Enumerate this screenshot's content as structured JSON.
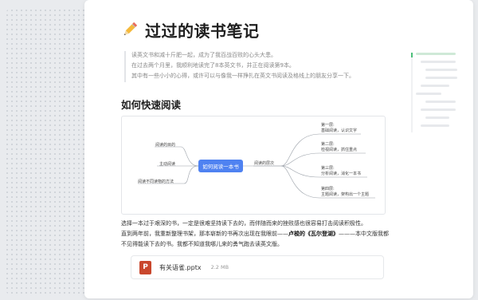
{
  "page": {
    "title": "过过的读书笔记",
    "title_icon": "pencil-icon"
  },
  "quote": {
    "lines": [
      "读英文书和减十斤肥一起，成为了我百战百败的心头大患。",
      "在过去两个月里，我顺利地读完了8本英文书，并正在阅读第9本。",
      "其中有一些小小的心得，或许可以与像我一样挣扎在英文书阅读及格线上的朋友分享一下。"
    ]
  },
  "section": {
    "heading": "如何快速阅读"
  },
  "mindmap": {
    "center": "如何阅读一本书",
    "left": [
      "阅读的目的",
      "主动阅读",
      "阅读不同读物的方法"
    ],
    "middle": "阅读的层次",
    "right": [
      {
        "title": "第一层:",
        "desc": "基础阅读，认识文字"
      },
      {
        "title": "第二层:",
        "desc": "检视阅读，抓住重点"
      },
      {
        "title": "第三层:",
        "desc": "分析阅读，消化一本书"
      },
      {
        "title": "第四层:",
        "desc": "主题阅读，架构出一个主题"
      }
    ]
  },
  "body": {
    "line1": "选择一本过于艰深的书，一定是很难坚持读下去的，而伴随而来的挫败感也很容易打击阅读积极性。",
    "line2_a": "直到两年前，我重新整理书架，那本崭新的书再次出现在我眼前——",
    "line2_bold": "卢梭的《瓦尔登湖》",
    "line2_b": "———本中文版我都",
    "line3": "不见得能读下去的书。我都不知道我哪儿来的勇气跑去读英文版。"
  },
  "attachment": {
    "icon_letter": "P",
    "name": "有关语雀.pptx",
    "size": "2.2 MB",
    "icon_color": "#c9472d"
  },
  "colors": {
    "accent": "#4f82f1",
    "toc_active": "#4cbf7a"
  }
}
